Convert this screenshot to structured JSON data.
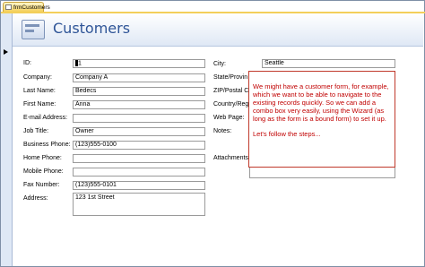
{
  "tab": {
    "label": "frmCustomers"
  },
  "header": {
    "title": "Customers"
  },
  "left_fields": [
    {
      "label": "ID:",
      "value": "1"
    },
    {
      "label": "Company:",
      "value": "Company A"
    },
    {
      "label": "Last Name:",
      "value": "Bedecs"
    },
    {
      "label": "First Name:",
      "value": "Anna"
    },
    {
      "label": "E-mail Address:",
      "value": ""
    },
    {
      "label": "Job Title:",
      "value": "Owner"
    },
    {
      "label": "Business Phone:",
      "value": "(123)555-0100"
    },
    {
      "label": "Home Phone:",
      "value": ""
    },
    {
      "label": "Mobile Phone:",
      "value": ""
    },
    {
      "label": "Fax Number:",
      "value": "(123)555-0101"
    },
    {
      "label": "Address:",
      "value": "123 1st Street"
    }
  ],
  "right_fields": [
    {
      "label": "City:",
      "value": "Seattle"
    },
    {
      "label": "State/Provin",
      "value": ""
    },
    {
      "label": "ZIP/Postal Co",
      "value": ""
    },
    {
      "label": "Country/Regi",
      "value": ""
    },
    {
      "label": "Web Page:",
      "value": ""
    },
    {
      "label": "Notes:",
      "value": ""
    },
    {
      "label": "Attachments:",
      "value": ""
    }
  ],
  "callout": {
    "para1": "We might have a customer form, for example, which we want to be able to navigate to the existing records quickly. So we can add a combo box very easily, using the Wizard (as long as the form is a bound form) to set it up.",
    "para2": "Let's follow the steps..."
  },
  "colors": {
    "title": "#2f5597",
    "callout_text": "#c00000",
    "callout_border": "#c0392b"
  }
}
